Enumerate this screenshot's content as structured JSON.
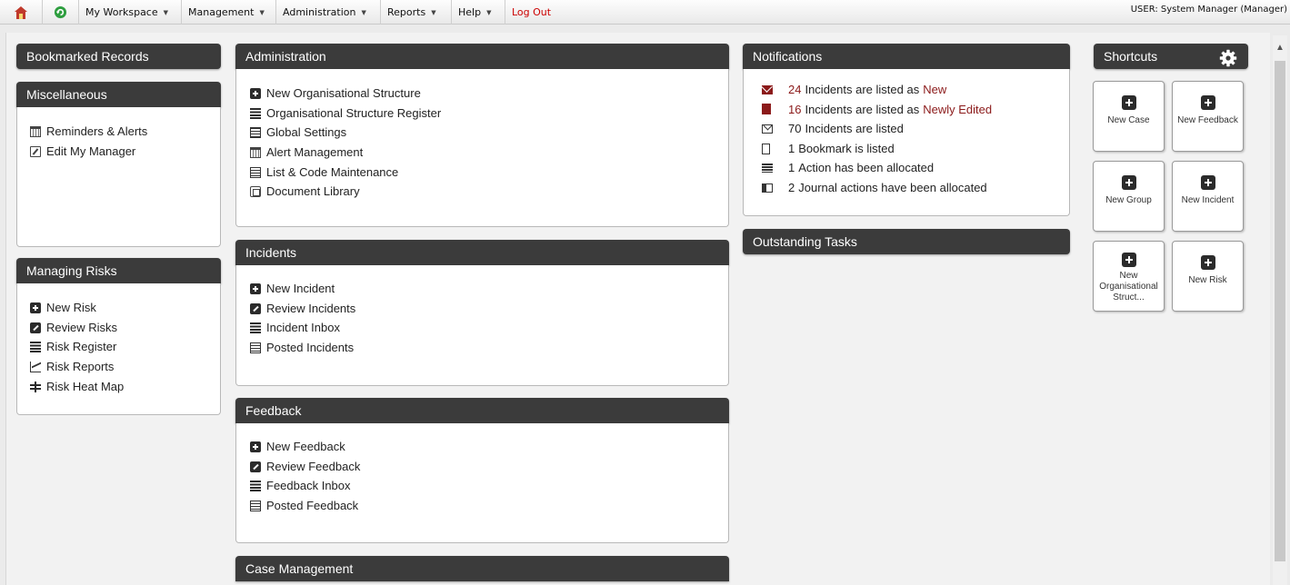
{
  "topbar": {
    "menu": [
      {
        "label": "My Workspace"
      },
      {
        "label": "Management"
      },
      {
        "label": "Administration"
      },
      {
        "label": "Reports"
      },
      {
        "label": "Help"
      }
    ],
    "logout": "Log Out",
    "user": "USER: System Manager (Manager)"
  },
  "bookmarked": {
    "title": "Bookmarked Records"
  },
  "misc": {
    "title": "Miscellaneous",
    "items": [
      {
        "label": "Reminders & Alerts",
        "icon": "calendar-icon"
      },
      {
        "label": "Edit My Manager",
        "icon": "edit-icon"
      }
    ]
  },
  "risks": {
    "title": "Managing Risks",
    "items": [
      {
        "label": "New Risk",
        "icon": "plus-icon"
      },
      {
        "label": "Review Risks",
        "icon": "edit-icon"
      },
      {
        "label": "Risk Register",
        "icon": "list-icon"
      },
      {
        "label": "Risk Reports",
        "icon": "chart-icon"
      },
      {
        "label": "Risk Heat Map",
        "icon": "heat-map-icon"
      }
    ]
  },
  "admin": {
    "title": "Administration",
    "items": [
      {
        "label": "New Organisational Structure",
        "icon": "plus-icon"
      },
      {
        "label": "Organisational Structure Register",
        "icon": "list-icon"
      },
      {
        "label": "Global Settings",
        "icon": "settings-icon"
      },
      {
        "label": "Alert Management",
        "icon": "calendar-icon"
      },
      {
        "label": "List & Code Maintenance",
        "icon": "table-icon"
      },
      {
        "label": "Document Library",
        "icon": "document-icon"
      }
    ]
  },
  "incidents": {
    "title": "Incidents",
    "items": [
      {
        "label": "New Incident",
        "icon": "plus-icon"
      },
      {
        "label": "Review Incidents",
        "icon": "edit-icon"
      },
      {
        "label": "Incident Inbox",
        "icon": "list-icon"
      },
      {
        "label": "Posted Incidents",
        "icon": "table-icon"
      }
    ]
  },
  "feedback": {
    "title": "Feedback",
    "items": [
      {
        "label": "New Feedback",
        "icon": "plus-icon"
      },
      {
        "label": "Review Feedback",
        "icon": "edit-icon"
      },
      {
        "label": "Feedback Inbox",
        "icon": "list-icon"
      },
      {
        "label": "Posted Feedback",
        "icon": "table-icon"
      }
    ]
  },
  "case_management": {
    "title": "Case Management"
  },
  "notifications": {
    "title": "Notifications",
    "items": [
      {
        "num": "24",
        "text": "Incidents are listed as",
        "highlight": "New",
        "icon": "mail-icon"
      },
      {
        "num": "16",
        "text": "Incidents are listed as",
        "highlight": "Newly Edited",
        "icon": "file-icon"
      },
      {
        "num": "70",
        "text": "Incidents are listed",
        "icon": "envelope-icon"
      },
      {
        "num": "1",
        "text": "Bookmark is listed",
        "icon": "bookmark-icon"
      },
      {
        "num": "1",
        "text": "Action has been allocated",
        "icon": "action-icon"
      },
      {
        "num": "2",
        "text": "Journal actions have been allocated",
        "icon": "journal-icon"
      }
    ]
  },
  "outstanding": {
    "title": "Outstanding Tasks"
  },
  "shortcuts": {
    "title": "Shortcuts",
    "tiles": [
      {
        "label": "New Case"
      },
      {
        "label": "New Feedback"
      },
      {
        "label": "New Group"
      },
      {
        "label": "New Incident"
      },
      {
        "label": "New Organisational Struct..."
      },
      {
        "label": "New Risk"
      }
    ]
  },
  "colors": {
    "header": "#3b3b3b",
    "accent_red": "#8b1a1a",
    "logout": "#cc0000"
  }
}
